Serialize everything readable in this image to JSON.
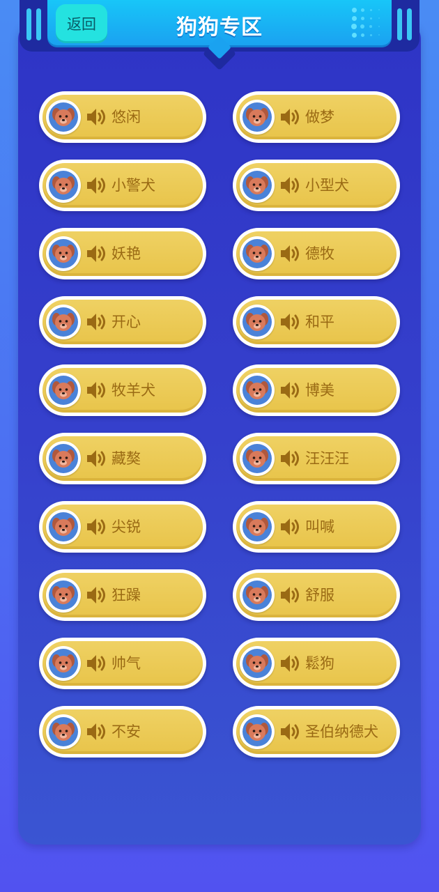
{
  "header": {
    "title": "狗狗专区",
    "back_label": "返回"
  },
  "colors": {
    "header_cyan": "#18c6f8",
    "back_button": "#24e2e0",
    "panel_blue": "#2e34c6",
    "pill_yellow": "#efd163",
    "label_brown": "#9a6a14"
  },
  "icons": {
    "avatar": "dog-face-icon",
    "speaker": "speaker-icon"
  },
  "sounds": [
    {
      "label": "悠闲"
    },
    {
      "label": "做梦"
    },
    {
      "label": "小警犬"
    },
    {
      "label": "小型犬"
    },
    {
      "label": "妖艳"
    },
    {
      "label": "德牧"
    },
    {
      "label": "开心"
    },
    {
      "label": "和平"
    },
    {
      "label": "牧羊犬"
    },
    {
      "label": "博美"
    },
    {
      "label": "藏獒"
    },
    {
      "label": "汪汪汪"
    },
    {
      "label": "尖锐"
    },
    {
      "label": "叫喊"
    },
    {
      "label": "狂躁"
    },
    {
      "label": "舒服"
    },
    {
      "label": "帅气"
    },
    {
      "label": "鬆狗"
    },
    {
      "label": "不安"
    },
    {
      "label": "圣伯纳德犬"
    }
  ]
}
